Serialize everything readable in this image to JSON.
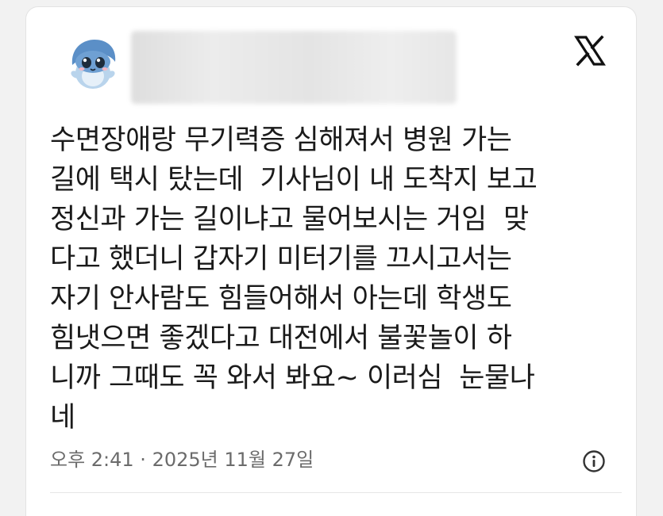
{
  "post": {
    "author": {
      "avatar_icon": "blue-ghost-mascot-avatar-icon",
      "name_blurred": true
    },
    "brand_icon": "x-logo-icon",
    "text_lines": [
      "수면장애랑 무기력증 심해져서 병원 가는",
      "길에 택시 탔는데  기사님이 내 도착지 보고",
      "정신과 가는 길이냐고 물어보시는 거임  맞",
      "다고 했더니 갑자기 미터기를 끄시고서는",
      "자기 안사람도 힘들어해서 아는데 학생도",
      "힘냇으면 좋겠다고 대전에서 불꽃놀이 하",
      "니까 그때도 꼭 와서 봐요~ 이러심  눈물나",
      "네"
    ],
    "timestamp": "오후 2:41 · 2025년 11월 27일",
    "info_icon": "info-icon"
  },
  "colors": {
    "card_bg": "#ffffff",
    "text": "#1a1a1a",
    "meta_text": "#6b6b6b",
    "avatar_blue": "#5b8fc7"
  }
}
